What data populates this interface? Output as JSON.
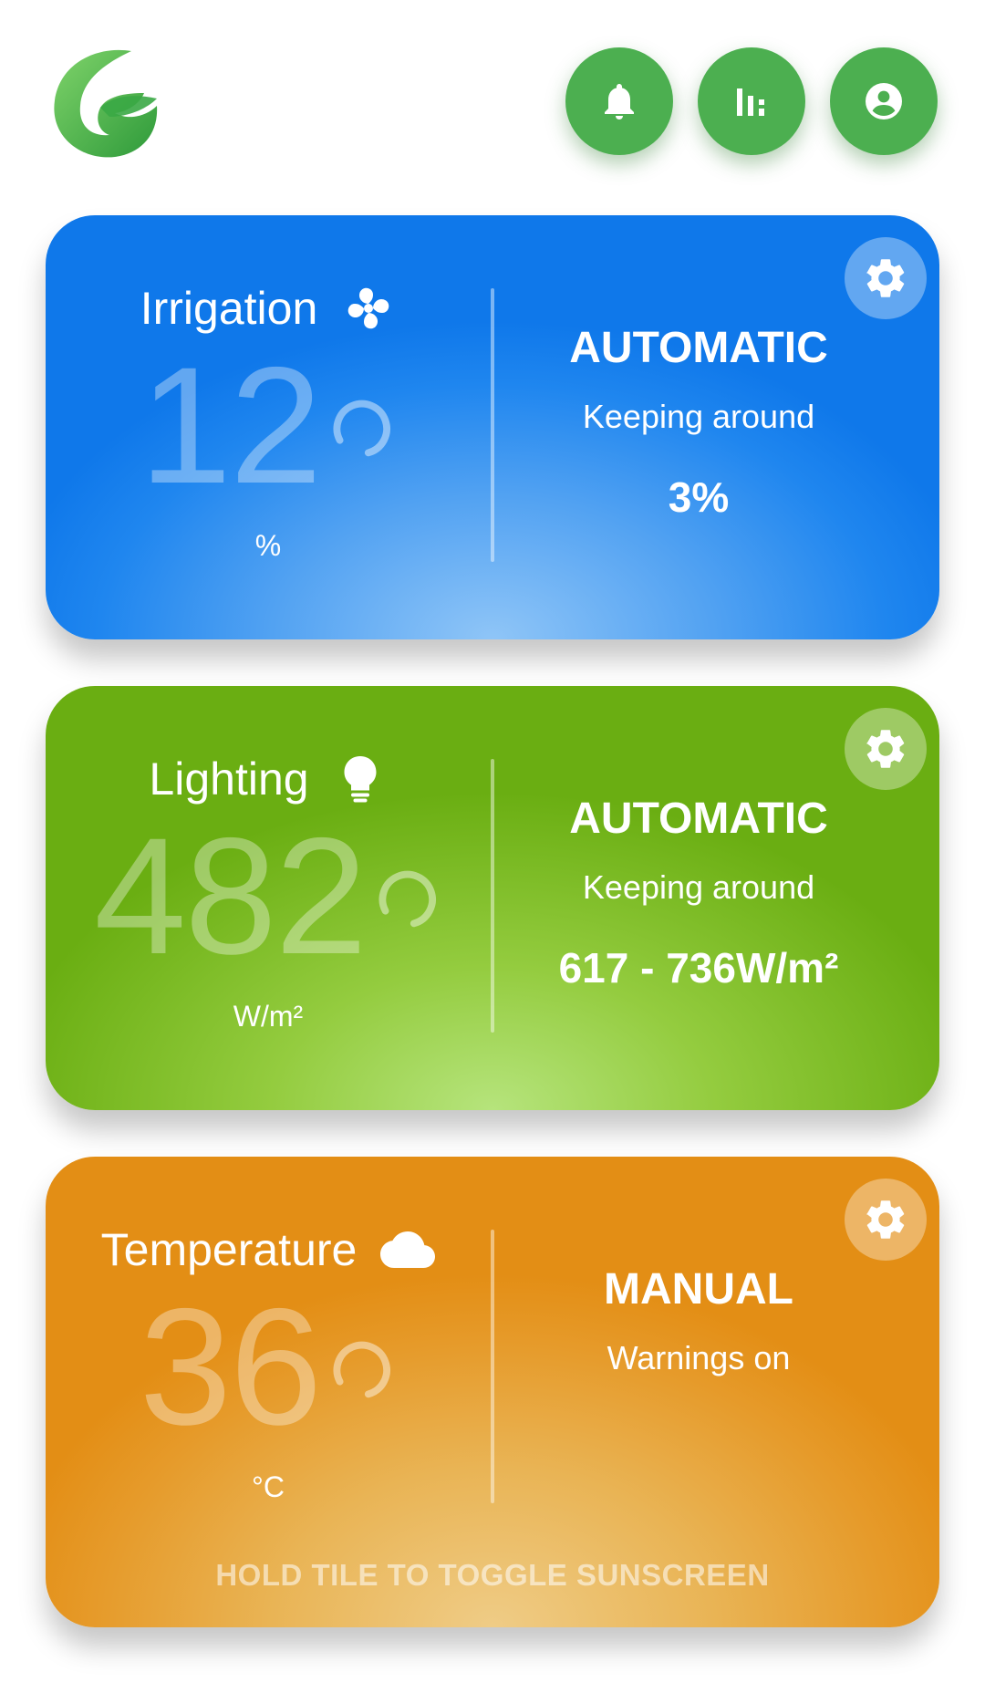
{
  "header": {
    "logo": "leaf-g-logo",
    "buttons": [
      {
        "icon": "bell-icon"
      },
      {
        "icon": "bar-chart-icon"
      },
      {
        "icon": "account-icon"
      }
    ],
    "accent_color": "#4caf50"
  },
  "tiles": [
    {
      "title": "Irrigation",
      "icon": "fan-icon",
      "value": "12",
      "unit": "%",
      "mode": "AUTOMATIC",
      "mode_desc": "Keeping around",
      "target": "3%",
      "color": "#1f86ef"
    },
    {
      "title": "Lighting",
      "icon": "lightbulb-icon",
      "value": "482",
      "unit": "W/m²",
      "mode": "AUTOMATIC",
      "mode_desc": "Keeping around",
      "target": "617 - 736W/m²",
      "color": "#79b922"
    },
    {
      "title": "Temperature",
      "icon": "cloud-icon",
      "value": "36",
      "unit": "°C",
      "mode": "MANUAL",
      "mode_desc": "Warnings on",
      "target": "",
      "hint": "HOLD TILE TO TOGGLE SUNSCREEN",
      "color": "#e69b2b"
    }
  ]
}
